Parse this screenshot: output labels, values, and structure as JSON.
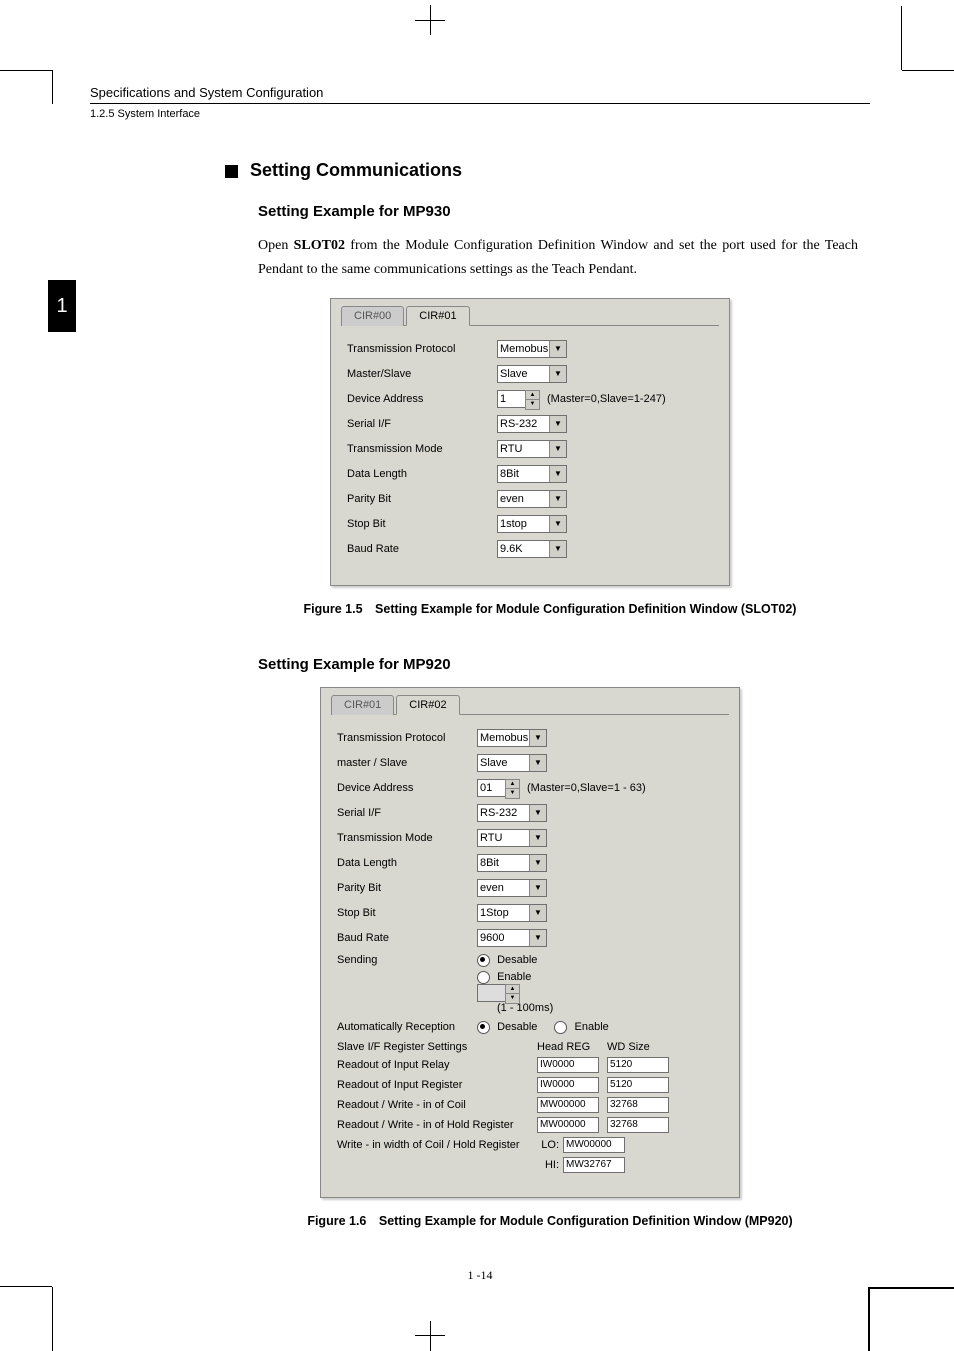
{
  "header": {
    "spec": "Specifications and System Configuration",
    "sys": "1.2.5  System Interface"
  },
  "sidetab": "1",
  "section": {
    "title": "Setting Communications"
  },
  "sub930": {
    "title": "Setting Example for MP930",
    "para_pre": "Open ",
    "para_bold": "SLOT02",
    "para_post": " from the Module Configuration Definition Window and set the port used for the Teach Pendant to the same communications settings as the Teach Pendant."
  },
  "sub920": {
    "title": "Setting Example for MP920"
  },
  "fig1": "Figure 1.5 Setting Example for Module Configuration Definition Window (SLOT02)",
  "fig2": "Figure 1.6 Setting Example for Module Configuration Definition Window (MP920)",
  "pagenum": "1 -14",
  "shot1": {
    "tabs": [
      "CIR#00",
      "CIR#01"
    ],
    "rows": {
      "protocol_label": "Transmission Protocol",
      "protocol_value": "Memobus",
      "ms_label": "Master/Slave",
      "ms_value": "Slave",
      "addr_label": "Device Address",
      "addr_value": "1",
      "addr_note": "(Master=0,Slave=1-247)",
      "serial_label": "Serial I/F",
      "serial_value": "RS-232",
      "mode_label": "Transmission Mode",
      "mode_value": "RTU",
      "dlen_label": "Data Length",
      "dlen_value": "8Bit",
      "parity_label": "Parity Bit",
      "parity_value": "even",
      "stop_label": "Stop Bit",
      "stop_value": "1stop",
      "baud_label": "Baud Rate",
      "baud_value": "9.6K"
    }
  },
  "shot2": {
    "tabs": [
      "CIR#01",
      "CIR#02"
    ],
    "rows": {
      "protocol_label": "Transmission Protocol",
      "protocol_value": "Memobus",
      "ms_label": "master / Slave",
      "ms_value": "Slave",
      "addr_label": "Device Address",
      "addr_value": "01",
      "addr_note": "(Master=0,Slave=1 - 63)",
      "serial_label": "Serial I/F",
      "serial_value": "RS-232",
      "mode_label": "Transmission Mode",
      "mode_value": "RTU",
      "dlen_label": "Data Length",
      "dlen_value": "8Bit",
      "parity_label": "Parity Bit",
      "parity_value": "even",
      "stop_label": "Stop Bit",
      "stop_value": "1Stop",
      "baud_label": "Baud Rate",
      "baud_value": "9600",
      "sending_label": "Sending",
      "sending_disable": "Desable",
      "sending_enable": "Enable",
      "sending_note": "(1 - 100ms)",
      "auto_label": "Automatically Reception",
      "auto_disable": "Desable",
      "auto_enable": "Enable",
      "slave_label": "Slave I/F Register Settings",
      "col_head1": "Head REG",
      "col_head2": "WD Size",
      "r1_label": "Readout of Input Relay",
      "r1_v1": "IW0000",
      "r1_v2": "5120",
      "r2_label": "Readout of Input Register",
      "r2_v1": "IW0000",
      "r2_v2": "5120",
      "r3_label": "Readout / Write - in of Coil",
      "r3_v1": "MW00000",
      "r3_v2": "32768",
      "r4_label": "Readout / Write - in of Hold Register",
      "r4_v1": "MW00000",
      "r4_v2": "32768",
      "r5_label": "Write - in width of Coil / Hold Register",
      "r5_lo_lbl": "LO:",
      "r5_lo": "MW00000",
      "r5_hi_lbl": "HI:",
      "r5_hi": "MW32767"
    }
  }
}
